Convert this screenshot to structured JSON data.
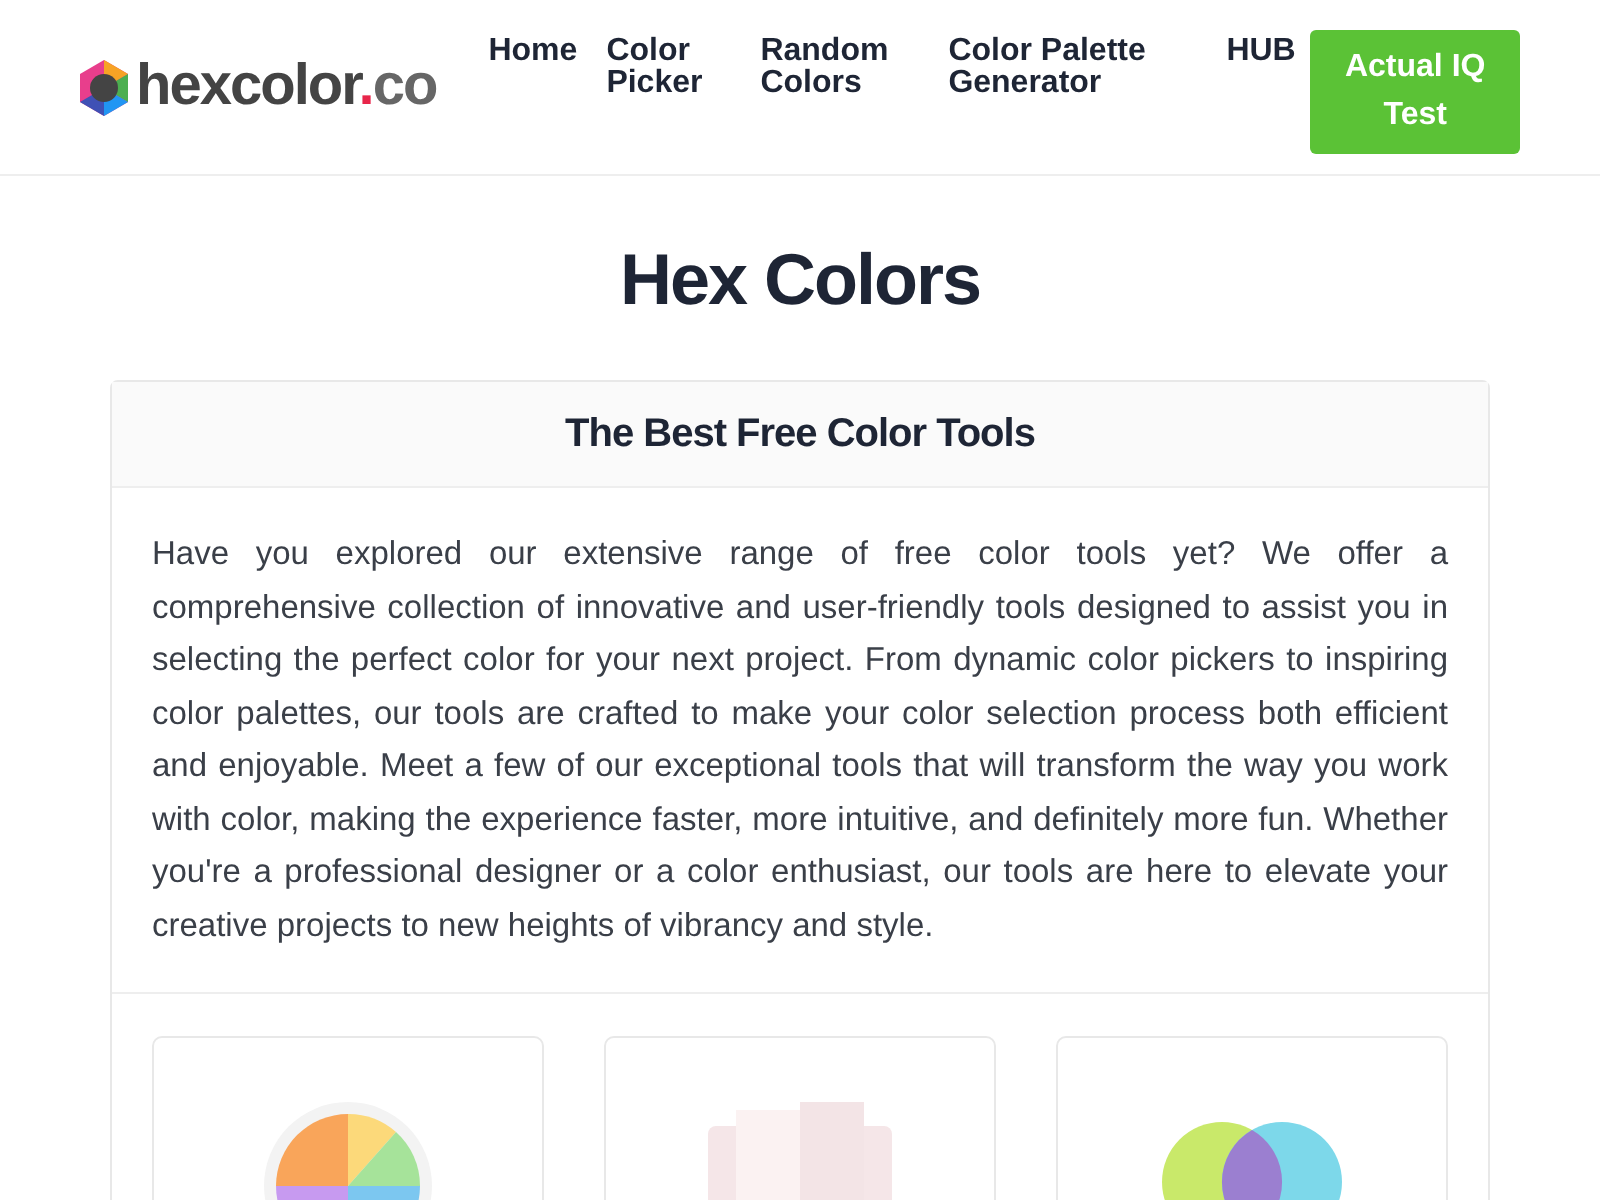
{
  "logo": {
    "parts": [
      "hexcolor",
      ".",
      "co"
    ]
  },
  "nav": [
    {
      "label": "Home"
    },
    {
      "label": "Color Picker"
    },
    {
      "label": "Random Colors"
    },
    {
      "label": "Color Palette Generator"
    },
    {
      "label": "HUB"
    }
  ],
  "cta_button": "Actual IQ Test",
  "title": "Hex Colors",
  "panel": {
    "heading": "The Best Free Color Tools",
    "text": "Have you explored our extensive range of free color tools yet? We offer a comprehensive collection of innovative and user-friendly tools designed to assist you in selecting the perfect color for your next project. From dynamic color pickers to inspiring color palettes, our tools are crafted to make your color selection process both efficient and enjoyable. Meet a few of our exceptional tools that will transform the way you work with color, making the experience faster, more intuitive, and definitely more fun. Whether you're a professional designer or a color enthusiast, our tools are here to elevate your creative projects to new heights of vibrancy and style.",
    "tools": [
      {
        "kind": "wheel"
      },
      {
        "kind": "swatches"
      },
      {
        "kind": "circles"
      }
    ]
  }
}
